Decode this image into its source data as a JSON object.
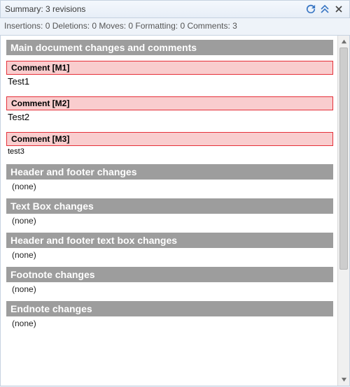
{
  "header": {
    "title": "Summary: 3 revisions"
  },
  "stats": {
    "line": "Insertions: 0 Deletions: 0 Moves: 0 Formatting: 0 Comments: 3"
  },
  "sections": {
    "main": "Main document changes and comments",
    "headerFooter": "Header and footer changes",
    "textBox": "Text Box changes",
    "hfTextBox": "Header and footer text box changes",
    "footnote": "Footnote changes",
    "endnote": "Endnote changes"
  },
  "noneLabel": "(none)",
  "comments": [
    {
      "label": "Comment [M1]",
      "text": "Test1"
    },
    {
      "label": "Comment [M2]",
      "text": "Test2"
    },
    {
      "label": "Comment [M3]",
      "text": "test3"
    }
  ]
}
